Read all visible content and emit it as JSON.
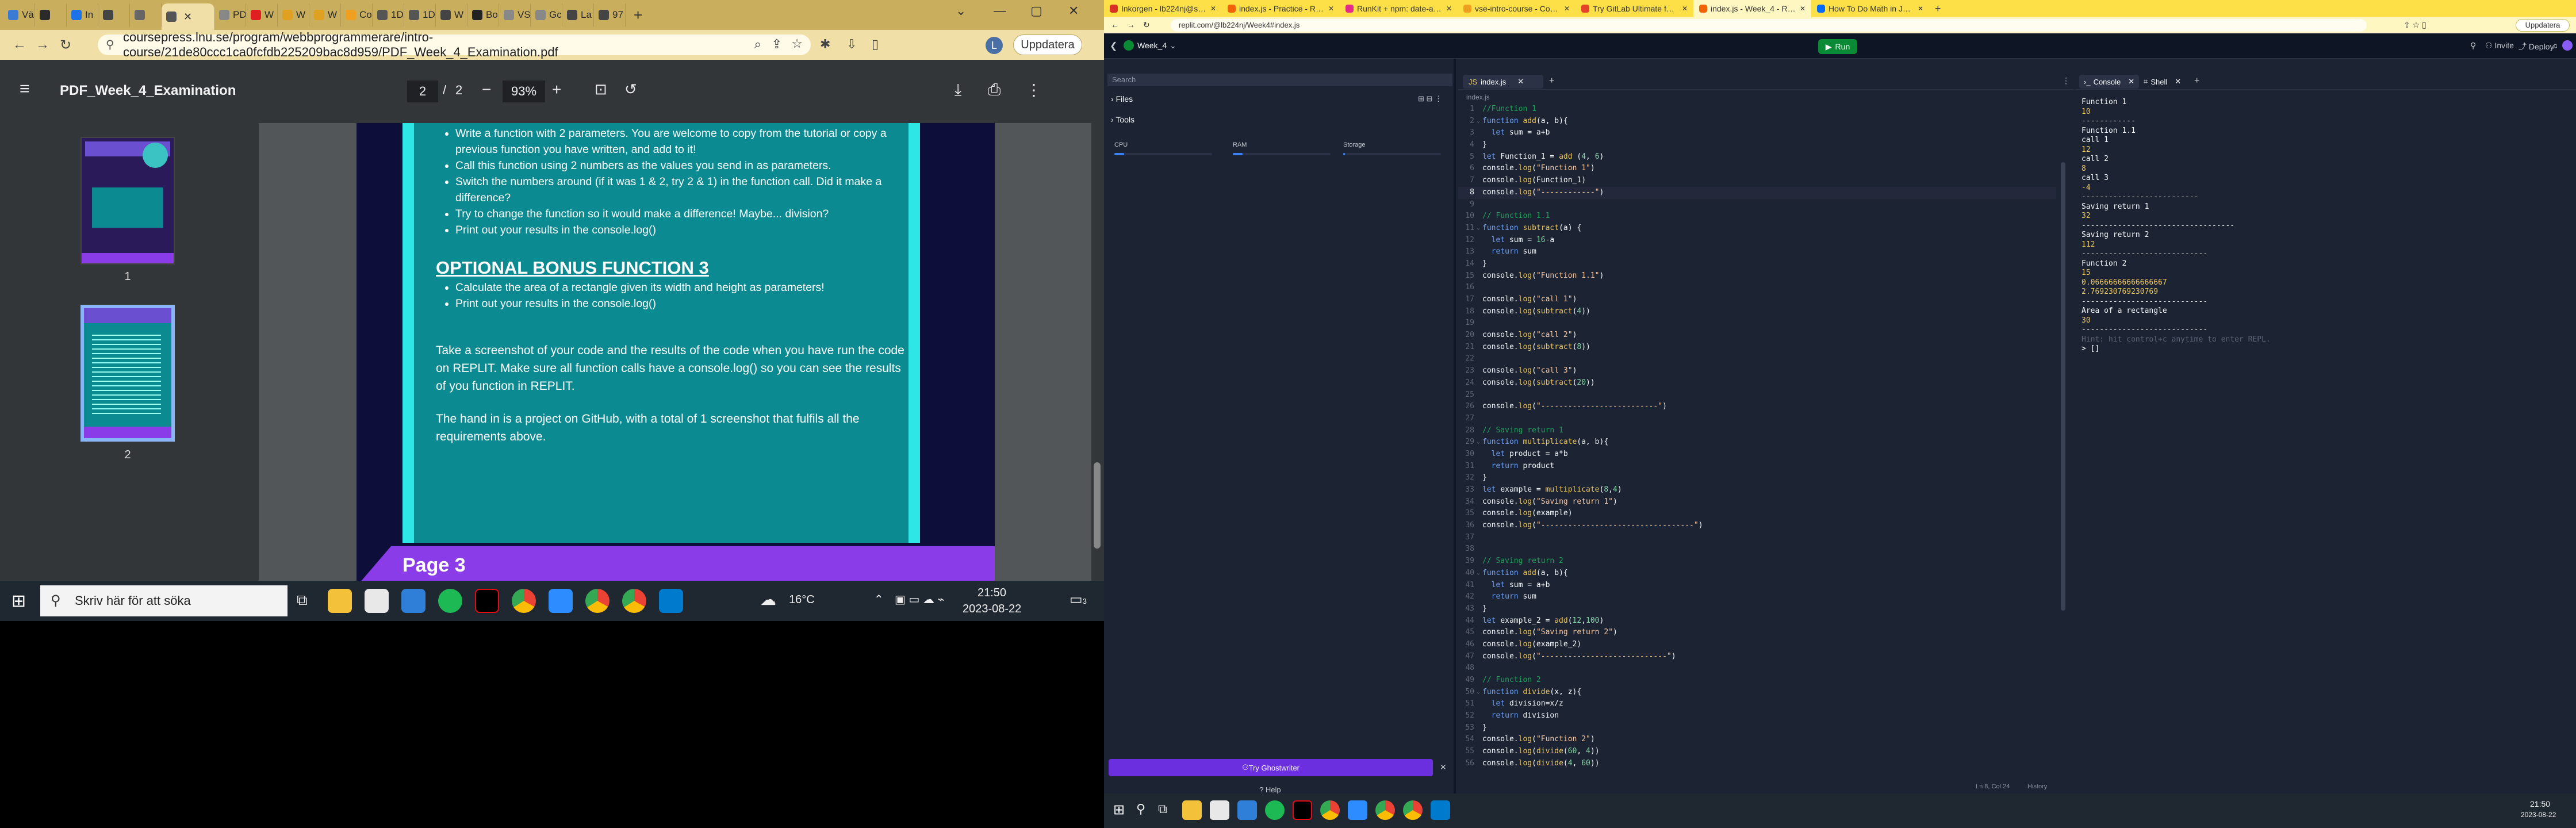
{
  "left": {
    "tabs": [
      {
        "label": "Vä",
        "color": "#3a7bd5"
      },
      {
        "label": "",
        "color": "#2b2b2b"
      },
      {
        "label": "In",
        "color": "#1a73e8"
      },
      {
        "label": "",
        "color": "#444444"
      },
      {
        "label": "",
        "color": "#666666"
      },
      {
        "label": "",
        "color": "#555555"
      },
      {
        "label": "PD",
        "color": "#888888"
      },
      {
        "label": "W",
        "color": "#e02020"
      },
      {
        "label": "W",
        "color": "#e0a020"
      },
      {
        "label": "W",
        "color": "#e0a020"
      },
      {
        "label": "Co",
        "color": "#f0a020"
      },
      {
        "label": "1D",
        "color": "#555555"
      },
      {
        "label": "1D",
        "color": "#555555"
      },
      {
        "label": "W",
        "color": "#444444"
      },
      {
        "label": "Bo",
        "color": "#222222"
      },
      {
        "label": "VS",
        "color": "#888888"
      },
      {
        "label": "Gc",
        "color": "#888888"
      },
      {
        "label": "La",
        "color": "#444444"
      },
      {
        "label": "97",
        "color": "#444444"
      }
    ],
    "new_tab": "+",
    "window_controls": [
      "⌄",
      "—",
      "▢",
      "✕"
    ],
    "url": "coursepress.lnu.se/program/webbprogrammerare/intro-course/21de80ccc1ca0fcfdb225209bac8d959/PDF_Week_4_Examination.pdf",
    "update_button": "Uppdatera",
    "profile_initial": "L",
    "pdf": {
      "title": "PDF_Week_4_Examination",
      "page_current": "2",
      "page_sep": "/",
      "page_total": "2",
      "zoom": "93%",
      "thumb_labels": [
        "1",
        "2"
      ],
      "bullets_top": [
        "Write a function with 2 parameters. You are welcome to copy from the tutorial or copy a previous function you have written, and add to it!",
        "Call this function using 2 numbers as the values you send in as parameters.",
        "Switch the numbers around (if it was 1 & 2, try 2 & 1) in the function call. Did it make a difference?",
        "Try to change the function so it would make a difference! Maybe... division?",
        "Print out your results in the console.log()"
      ],
      "heading": "OPTIONAL BONUS FUNCTION 3",
      "bullets_bonus": [
        "Calculate the area of a rectangle given its width and height as parameters!",
        "Print out your results in the console.log()"
      ],
      "para1": "Take a screenshot of your code and the results of the code when you have run the code on REPLIT. Make sure all function calls have a console.log() so you can see the results of you function in REPLIT.",
      "para2": "The hand in is a project on GitHub, with a total of 1 screenshot that fulfils all the requirements above.",
      "footer": "Page 3"
    },
    "taskbar": {
      "search_placeholder": "Skriv här för att söka",
      "weather": "16°C",
      "time": "21:50",
      "date": "2023-08-22",
      "notif": "3"
    }
  },
  "right": {
    "tabs": [
      {
        "label": "Inkorgen - lb224nj@student.lnu",
        "color": "#d93025"
      },
      {
        "label": "index.js - Practice - Replit",
        "color": "#f26207"
      },
      {
        "label": "RunKit + npm: date-and-time",
        "color": "#e52b8a"
      },
      {
        "label": "vse-intro-course - CoursePress",
        "color": "#f0a020"
      },
      {
        "label": "Try GitLab Ultimate for free | GitLab",
        "color": "#e24329"
      },
      {
        "label": "index.js - Week_4 - Replit",
        "color": "#f26207"
      },
      {
        "label": "How To Do Math in JavaScript with...",
        "color": "#0069ff"
      }
    ],
    "new_tab": "+",
    "url": "replit.com/@lb224nj/Week4#index.js",
    "update_button": "Uppdatera",
    "replit": {
      "project": "Week_4",
      "run": "Run",
      "invite": "Invite",
      "deploy": "Deploy",
      "search_placeholder": "Search",
      "files": "Files",
      "tools": "Tools",
      "resources": [
        {
          "label": "CPU",
          "value": 0.1
        },
        {
          "label": "RAM",
          "value": 0.1
        },
        {
          "label": "Storage",
          "value": 0.02
        }
      ],
      "ghostwriter": "Try Ghostwriter",
      "help": "Help",
      "editor_tab": "index.js",
      "breadcrumb": "index.js",
      "status_pos": "Ln 8, Col 24",
      "status_history": "History",
      "console_tab": "Console",
      "shell_tab": "Shell"
    },
    "code": [
      [
        [
          "c",
          "//Function 1"
        ]
      ],
      [
        [
          "k",
          "function "
        ],
        [
          "f",
          "add"
        ],
        [
          "p",
          "(a, b){"
        ]
      ],
      [
        [
          "p",
          "  "
        ],
        [
          "k",
          "let "
        ],
        [
          "p",
          "sum = a+b"
        ]
      ],
      [
        [
          "p",
          "}"
        ]
      ],
      [
        [
          "k",
          "let "
        ],
        [
          "p",
          "Function_1 = "
        ],
        [
          "f",
          "add"
        ],
        [
          "p",
          " ("
        ],
        [
          "n",
          "4"
        ],
        [
          "p",
          ", "
        ],
        [
          "n",
          "6"
        ],
        [
          "p",
          ")"
        ]
      ],
      [
        [
          "p",
          "console."
        ],
        [
          "f",
          "log"
        ],
        [
          "p",
          "("
        ],
        [
          "s",
          "\"Function 1\""
        ],
        [
          "p",
          ")"
        ]
      ],
      [
        [
          "p",
          "console."
        ],
        [
          "f",
          "log"
        ],
        [
          "p",
          "(Function_1)"
        ]
      ],
      [
        [
          "p",
          "console."
        ],
        [
          "f",
          "log"
        ],
        [
          "p",
          "("
        ],
        [
          "s",
          "\"------------\""
        ],
        [
          "p",
          ")"
        ]
      ],
      [
        [
          "p",
          ""
        ]
      ],
      [
        [
          "c",
          "// Function 1.1"
        ]
      ],
      [
        [
          "k",
          "function "
        ],
        [
          "f",
          "subtract"
        ],
        [
          "p",
          "(a) {"
        ]
      ],
      [
        [
          "p",
          "  "
        ],
        [
          "k",
          "let "
        ],
        [
          "p",
          "sum = "
        ],
        [
          "n",
          "16"
        ],
        [
          "p",
          "-a"
        ]
      ],
      [
        [
          "p",
          "  "
        ],
        [
          "k",
          "return "
        ],
        [
          "p",
          "sum"
        ]
      ],
      [
        [
          "p",
          "}"
        ]
      ],
      [
        [
          "p",
          "console."
        ],
        [
          "f",
          "log"
        ],
        [
          "p",
          "("
        ],
        [
          "s",
          "\"Function 1.1\""
        ],
        [
          "p",
          ")"
        ]
      ],
      [
        [
          "p",
          ""
        ]
      ],
      [
        [
          "p",
          "console."
        ],
        [
          "f",
          "log"
        ],
        [
          "p",
          "("
        ],
        [
          "s",
          "\"call 1\""
        ],
        [
          "p",
          ")"
        ]
      ],
      [
        [
          "p",
          "console."
        ],
        [
          "f",
          "log"
        ],
        [
          "p",
          "("
        ],
        [
          "f",
          "subtract"
        ],
        [
          "p",
          "("
        ],
        [
          "n",
          "4"
        ],
        [
          "p",
          "))"
        ]
      ],
      [
        [
          "p",
          ""
        ]
      ],
      [
        [
          "p",
          "console."
        ],
        [
          "f",
          "log"
        ],
        [
          "p",
          "("
        ],
        [
          "s",
          "\"call 2\""
        ],
        [
          "p",
          ")"
        ]
      ],
      [
        [
          "p",
          "console."
        ],
        [
          "f",
          "log"
        ],
        [
          "p",
          "("
        ],
        [
          "f",
          "subtract"
        ],
        [
          "p",
          "("
        ],
        [
          "n",
          "8"
        ],
        [
          "p",
          "))"
        ]
      ],
      [
        [
          "p",
          ""
        ]
      ],
      [
        [
          "p",
          "console."
        ],
        [
          "f",
          "log"
        ],
        [
          "p",
          "("
        ],
        [
          "s",
          "\"call 3\""
        ],
        [
          "p",
          ")"
        ]
      ],
      [
        [
          "p",
          "console."
        ],
        [
          "f",
          "log"
        ],
        [
          "p",
          "("
        ],
        [
          "f",
          "subtract"
        ],
        [
          "p",
          "("
        ],
        [
          "n",
          "20"
        ],
        [
          "p",
          "))"
        ]
      ],
      [
        [
          "p",
          ""
        ]
      ],
      [
        [
          "p",
          "console."
        ],
        [
          "f",
          "log"
        ],
        [
          "p",
          "("
        ],
        [
          "s",
          "\"--------------------------\""
        ],
        [
          "p",
          ")"
        ]
      ],
      [
        [
          "p",
          ""
        ]
      ],
      [
        [
          "c",
          "// Saving return 1"
        ]
      ],
      [
        [
          "k",
          "function "
        ],
        [
          "f",
          "multiplicate"
        ],
        [
          "p",
          "(a, b){"
        ]
      ],
      [
        [
          "p",
          "  "
        ],
        [
          "k",
          "let "
        ],
        [
          "p",
          "product = a*b"
        ]
      ],
      [
        [
          "p",
          "  "
        ],
        [
          "k",
          "return "
        ],
        [
          "p",
          "product"
        ]
      ],
      [
        [
          "p",
          "}"
        ]
      ],
      [
        [
          "k",
          "let "
        ],
        [
          "p",
          "example = "
        ],
        [
          "f",
          "multiplicate"
        ],
        [
          "p",
          "("
        ],
        [
          "n",
          "8"
        ],
        [
          "p",
          ","
        ],
        [
          "n",
          "4"
        ],
        [
          "p",
          ")"
        ]
      ],
      [
        [
          "p",
          "console."
        ],
        [
          "f",
          "log"
        ],
        [
          "p",
          "("
        ],
        [
          "s",
          "\"Saving return 1\""
        ],
        [
          "p",
          ")"
        ]
      ],
      [
        [
          "p",
          "console."
        ],
        [
          "f",
          "log"
        ],
        [
          "p",
          "(example)"
        ]
      ],
      [
        [
          "p",
          "console."
        ],
        [
          "f",
          "log"
        ],
        [
          "p",
          "("
        ],
        [
          "s",
          "\"----------------------------------\""
        ],
        [
          "p",
          ")"
        ]
      ],
      [
        [
          "p",
          ""
        ]
      ],
      [
        [
          "p",
          ""
        ]
      ],
      [
        [
          "c",
          "// Saving return 2"
        ]
      ],
      [
        [
          "k",
          "function "
        ],
        [
          "f",
          "add"
        ],
        [
          "p",
          "(a, b){"
        ]
      ],
      [
        [
          "p",
          "  "
        ],
        [
          "k",
          "let "
        ],
        [
          "p",
          "sum = a+b"
        ]
      ],
      [
        [
          "p",
          "  "
        ],
        [
          "k",
          "return "
        ],
        [
          "p",
          "sum"
        ]
      ],
      [
        [
          "p",
          "}"
        ]
      ],
      [
        [
          "k",
          "let "
        ],
        [
          "p",
          "example_2 = "
        ],
        [
          "f",
          "add"
        ],
        [
          "p",
          "("
        ],
        [
          "n",
          "12"
        ],
        [
          "p",
          ","
        ],
        [
          "n",
          "100"
        ],
        [
          "p",
          ")"
        ]
      ],
      [
        [
          "p",
          "console."
        ],
        [
          "f",
          "log"
        ],
        [
          "p",
          "("
        ],
        [
          "s",
          "\"Saving return 2\""
        ],
        [
          "p",
          ")"
        ]
      ],
      [
        [
          "p",
          "console."
        ],
        [
          "f",
          "log"
        ],
        [
          "p",
          "(example_2)"
        ]
      ],
      [
        [
          "p",
          "console."
        ],
        [
          "f",
          "log"
        ],
        [
          "p",
          "("
        ],
        [
          "s",
          "\"----------------------------\""
        ],
        [
          "p",
          ")"
        ]
      ],
      [
        [
          "p",
          ""
        ]
      ],
      [
        [
          "c",
          "// Function 2"
        ]
      ],
      [
        [
          "k",
          "function "
        ],
        [
          "f",
          "divide"
        ],
        [
          "p",
          "(x, z){"
        ]
      ],
      [
        [
          "p",
          "  "
        ],
        [
          "k",
          "let "
        ],
        [
          "p",
          "division=x/z"
        ]
      ],
      [
        [
          "p",
          "  "
        ],
        [
          "k",
          "return "
        ],
        [
          "p",
          "division"
        ]
      ],
      [
        [
          "p",
          "}"
        ]
      ],
      [
        [
          "p",
          "console."
        ],
        [
          "f",
          "log"
        ],
        [
          "p",
          "("
        ],
        [
          "s",
          "\"Function 2\""
        ],
        [
          "p",
          ")"
        ]
      ],
      [
        [
          "p",
          "console."
        ],
        [
          "f",
          "log"
        ],
        [
          "p",
          "("
        ],
        [
          "f",
          "divide"
        ],
        [
          "p",
          "("
        ],
        [
          "n",
          "60"
        ],
        [
          "p",
          ", "
        ],
        [
          "n",
          "4"
        ],
        [
          "p",
          "))"
        ]
      ],
      [
        [
          "p",
          "console."
        ],
        [
          "f",
          "log"
        ],
        [
          "p",
          "("
        ],
        [
          "f",
          "divide"
        ],
        [
          "p",
          "("
        ],
        [
          "n",
          "4"
        ],
        [
          "p",
          ", "
        ],
        [
          "n",
          "60"
        ],
        [
          "p",
          "))"
        ]
      ]
    ],
    "fold_lines": [
      2,
      11,
      29,
      40,
      50
    ],
    "current_line": 8,
    "console_out": [
      [
        "s",
        "Function 1"
      ],
      [
        "n",
        "10"
      ],
      [
        "s",
        "------------"
      ],
      [
        "s",
        "Function 1.1"
      ],
      [
        "s",
        "call 1"
      ],
      [
        "n",
        "12"
      ],
      [
        "s",
        "call 2"
      ],
      [
        "n",
        "8"
      ],
      [
        "s",
        "call 3"
      ],
      [
        "n",
        "-4"
      ],
      [
        "s",
        "--------------------------"
      ],
      [
        "s",
        "Saving return 1"
      ],
      [
        "n",
        "32"
      ],
      [
        "s",
        "----------------------------------"
      ],
      [
        "s",
        "Saving return 2"
      ],
      [
        "n",
        "112"
      ],
      [
        "s",
        "----------------------------"
      ],
      [
        "s",
        "Function 2"
      ],
      [
        "n",
        "15"
      ],
      [
        "n",
        "0.06666666666666667"
      ],
      [
        "n",
        "2.769230769230769"
      ],
      [
        "s",
        "----------------------------"
      ],
      [
        "s",
        "Area of a rectangle"
      ],
      [
        "n",
        "30"
      ],
      [
        "s",
        "----------------------------"
      ],
      [
        "h",
        "Hint: hit control+c anytime to enter REPL."
      ],
      [
        "p",
        "> []"
      ]
    ],
    "taskbar": {
      "time": "21:50",
      "date": "2023-08-22"
    }
  }
}
